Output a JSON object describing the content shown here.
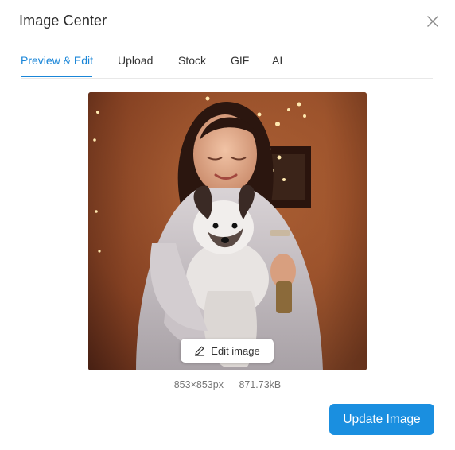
{
  "dialog": {
    "title": "Image Center",
    "close_icon": "close-icon"
  },
  "tabs": [
    {
      "label": "Preview & Edit",
      "active": true
    },
    {
      "label": "Upload",
      "active": false
    },
    {
      "label": "Stock",
      "active": false
    },
    {
      "label": "GIF",
      "active": false
    },
    {
      "label": "AI",
      "active": false
    }
  ],
  "preview": {
    "edit_label": "Edit image",
    "edit_icon": "pencil-icon",
    "dimensions": "853×853px",
    "file_size": "871.73kB"
  },
  "footer": {
    "update_label": "Update Image"
  },
  "colors": {
    "accent": "#1a86d8",
    "button": "#1a8fe0"
  }
}
